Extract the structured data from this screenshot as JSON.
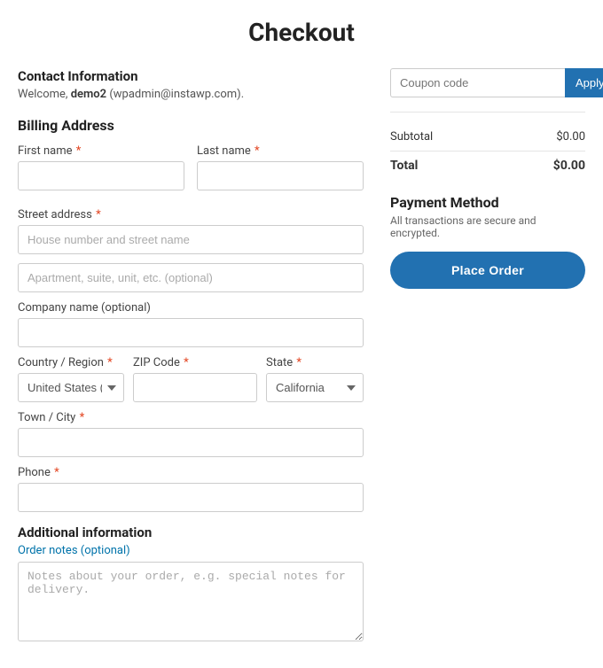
{
  "page": {
    "title": "Checkout"
  },
  "contact": {
    "section_title": "Contact Information",
    "welcome_text": "Welcome,",
    "username": "demo2",
    "email": "wpadmin@instawp.com"
  },
  "billing": {
    "section_title": "Billing Address",
    "fields": {
      "first_name_label": "First name",
      "last_name_label": "Last name",
      "street_address_label": "Street address",
      "street_placeholder": "House number and street name",
      "apartment_placeholder": "Apartment, suite, unit, etc. (optional)",
      "company_label": "Company name (optional)",
      "country_label": "Country / Region",
      "zip_label": "ZIP Code",
      "state_label": "State",
      "town_label": "Town / City",
      "phone_label": "Phone",
      "country_value": "United States (...",
      "state_value": "California"
    }
  },
  "additional": {
    "section_title": "Additional information",
    "notes_label": "Order notes (optional)",
    "notes_placeholder": "Notes about your order, e.g. special notes for delivery."
  },
  "coupon": {
    "placeholder": "Coupon code",
    "button_label": "Apply Coupon"
  },
  "order_summary": {
    "subtotal_label": "Subtotal",
    "subtotal_value": "$0.00",
    "total_label": "Total",
    "total_value": "$0.00"
  },
  "payment": {
    "section_title": "Payment Method",
    "description": "All transactions are secure and encrypted.",
    "place_order_label": "Place Order"
  }
}
